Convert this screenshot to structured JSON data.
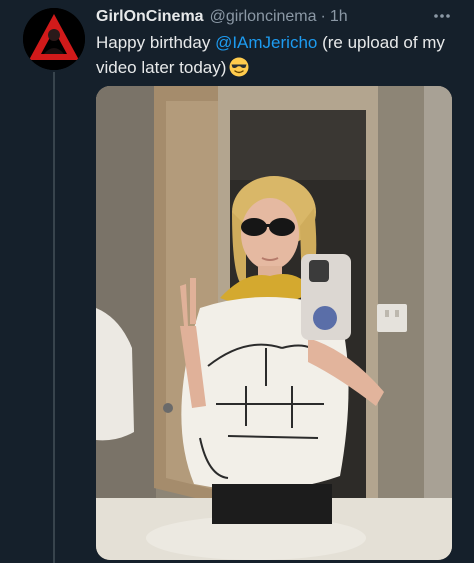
{
  "tweet": {
    "display_name": "GirlOnCinema",
    "handle": "@girloncinema",
    "separator": "·",
    "time": "1h",
    "text_before": "Happy birthday ",
    "mention": "@IAmJericho",
    "text_after": " (re upload of my video later today)",
    "emoji": "smiling-face-with-sunglasses"
  },
  "icons": {
    "more": "more-horizontal-icon",
    "avatar": "avatar-logo"
  },
  "colors": {
    "background": "#15202b",
    "mention": "#1d9bf0",
    "secondary_text": "#8b98a5",
    "thread_line": "#38444d"
  }
}
